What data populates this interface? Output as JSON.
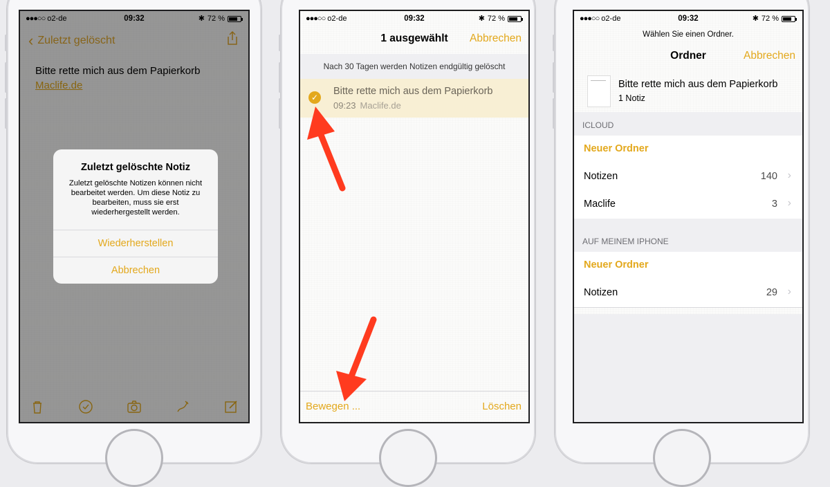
{
  "status": {
    "carrier": "o2-de",
    "dots": "●●●○○",
    "time": "09:32",
    "battery": "72 %",
    "battery_level": 0.72
  },
  "phone1": {
    "back_label": "Zuletzt gelöscht",
    "note_title": "Bitte rette mich aus dem Papierkorb",
    "note_link": "Maclife.de",
    "alert": {
      "title": "Zuletzt gelöschte Notiz",
      "message": "Zuletzt gelöschte Notizen können nicht bearbeitet werden. Um diese Notiz zu bearbeiten, muss sie erst wiederhergestellt werden.",
      "restore_label": "Wiederherstellen",
      "cancel_label": "Abbrechen"
    },
    "toolbar_icons": [
      "trash-icon",
      "checklist-icon",
      "camera-icon",
      "sketch-icon",
      "compose-icon"
    ]
  },
  "phone2": {
    "nav_title": "1 ausgewählt",
    "cancel_label": "Abbrechen",
    "banner": "Nach 30 Tagen werden Notizen endgültig gelöscht",
    "row": {
      "title": "Bitte rette mich aus dem Papierkorb",
      "time": "09:23",
      "preview": "Maclife.de"
    },
    "move_label": "Bewegen ...",
    "delete_label": "Löschen"
  },
  "phone3": {
    "prompt": "Wählen Sie einen Ordner.",
    "nav_title": "Ordner",
    "cancel_label": "Abbrechen",
    "note": {
      "title": "Bitte rette mich aus dem Papierkorb",
      "count": "1 Notiz"
    },
    "sections": [
      {
        "header": "ICLOUD",
        "rows": [
          {
            "name": "Neuer Ordner",
            "count": ""
          },
          {
            "name": "Notizen",
            "count": "140"
          },
          {
            "name": "Maclife",
            "count": "3"
          }
        ]
      },
      {
        "header": "AUF MEINEM IPHONE",
        "rows": [
          {
            "name": "Neuer Ordner",
            "count": ""
          },
          {
            "name": "Notizen",
            "count": "29"
          }
        ]
      }
    ]
  },
  "colors": {
    "accent": "#e3a81c",
    "arrow": "#ff3b1f"
  }
}
